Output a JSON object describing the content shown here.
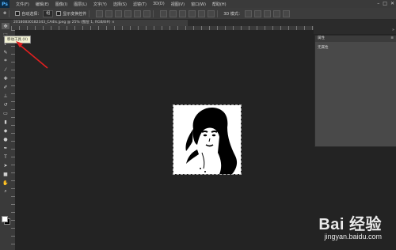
{
  "app": {
    "logo": "Ps"
  },
  "menu": [
    "文件(F)",
    "编辑(E)",
    "图像(I)",
    "图层(L)",
    "文字(Y)",
    "选择(S)",
    "滤镜(T)",
    "3D(D)",
    "视图(V)",
    "窗口(W)",
    "帮助(H)"
  ],
  "window_controls": [
    "–",
    "□",
    "✕"
  ],
  "options": {
    "auto_select_label": "自动选择：",
    "auto_select_value": "组",
    "show_transform_label": "显示变换控件",
    "mode_3d_label": "3D 模式："
  },
  "document_tab": {
    "title": "20180830182343_CA4Is.jpeg @ 25% (图层 1, RGB/8#) ×",
    "close": "×"
  },
  "tooltip": {
    "text": "移动工具 (V)"
  },
  "panel": {
    "header": "属性",
    "body": "无属性",
    "menu_icon": "≡"
  },
  "watermark": {
    "main": "Bai 经验",
    "sub": "jingyan.baidu.com"
  },
  "tools": [
    {
      "name": "move-tool",
      "glyph": "✥"
    },
    {
      "name": "marquee-tool",
      "glyph": "⬚"
    },
    {
      "name": "lasso-tool",
      "glyph": "ℓ"
    },
    {
      "name": "quick-select-tool",
      "glyph": "✎"
    },
    {
      "name": "crop-tool",
      "glyph": "⌗"
    },
    {
      "name": "eyedropper-tool",
      "glyph": "⁄"
    },
    {
      "name": "healing-tool",
      "glyph": "✚"
    },
    {
      "name": "brush-tool",
      "glyph": "✐"
    },
    {
      "name": "stamp-tool",
      "glyph": "⊥"
    },
    {
      "name": "history-brush-tool",
      "glyph": "↺"
    },
    {
      "name": "eraser-tool",
      "glyph": "▭"
    },
    {
      "name": "gradient-tool",
      "glyph": "▮"
    },
    {
      "name": "blur-tool",
      "glyph": "◆"
    },
    {
      "name": "dodge-tool",
      "glyph": "●"
    },
    {
      "name": "pen-tool",
      "glyph": "✒"
    },
    {
      "name": "type-tool",
      "glyph": "T"
    },
    {
      "name": "path-select-tool",
      "glyph": "➤"
    },
    {
      "name": "shape-tool",
      "glyph": "■"
    },
    {
      "name": "hand-tool",
      "glyph": "✋"
    },
    {
      "name": "zoom-tool",
      "glyph": "⌕"
    }
  ],
  "colors": {
    "foreground": "#ffffff",
    "background": "#000000",
    "annotation_arrow": "#e02020"
  }
}
